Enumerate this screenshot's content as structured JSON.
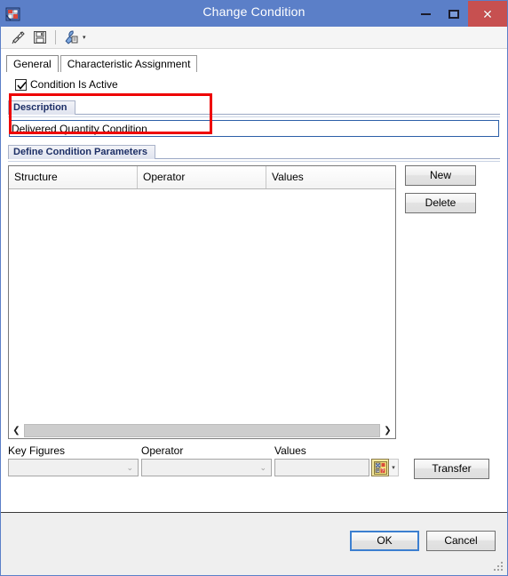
{
  "window": {
    "title": "Change Condition",
    "app_icon": "sap-condition-icon",
    "controls": {
      "minimize": "minimize-icon",
      "maximize": "maximize-icon",
      "close": "close-icon"
    }
  },
  "toolbar": {
    "items": [
      {
        "name": "check-pencil-icon",
        "label": ""
      },
      {
        "name": "save-icon",
        "label": ""
      },
      {
        "name": "settings-wrench-icon",
        "label": "",
        "caret": "▾"
      }
    ]
  },
  "tabs": [
    {
      "label": "General",
      "active": true
    },
    {
      "label": "Characteristic Assignment",
      "active": false
    }
  ],
  "general": {
    "condition_active": {
      "label": "Condition Is Active",
      "checked": true,
      "check_glyph": "✔"
    },
    "description_group": {
      "title": "Description",
      "value": "Delivered Quantity Condition",
      "placeholder": ""
    },
    "parameters_group": {
      "title": "Define Condition Parameters",
      "table": {
        "columns": [
          "Structure",
          "Operator",
          "Values"
        ],
        "rows": []
      },
      "scrollbar": {
        "left_arrow": "❮",
        "right_arrow": "❯"
      },
      "buttons": {
        "new": "New",
        "delete": "Delete"
      }
    },
    "entry_row": {
      "key_figures": {
        "label": "Key Figures",
        "value": "",
        "chevron": "⌄"
      },
      "operator": {
        "label": "Operator",
        "value": "",
        "chevron": "⌄"
      },
      "values": {
        "label": "Values",
        "value": ""
      },
      "value_help_icon": "value-help-icon",
      "value_help_caret": "▾",
      "transfer": "Transfer"
    }
  },
  "footer": {
    "ok": "OK",
    "cancel": "Cancel"
  },
  "annotation": {
    "highlight_color": "#ee0000"
  }
}
